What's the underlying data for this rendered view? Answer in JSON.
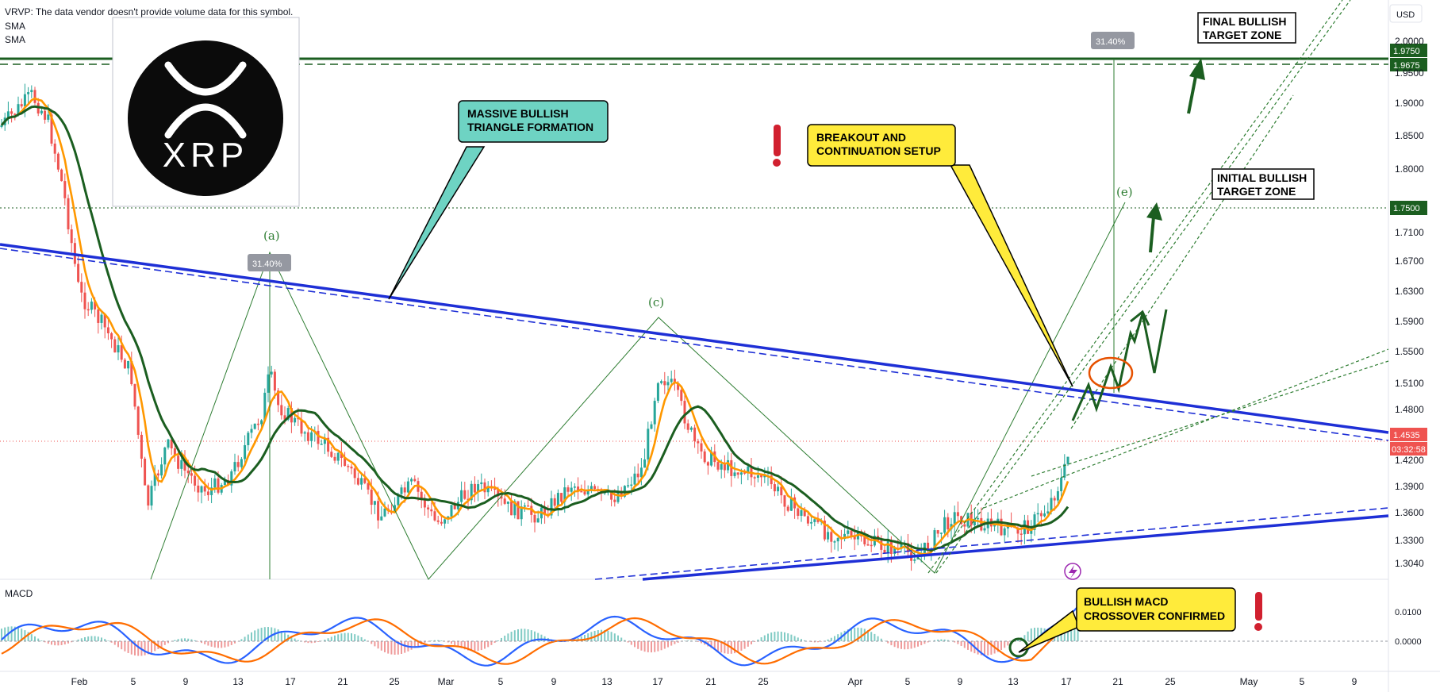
{
  "indicators": {
    "vrvp_note": "VRVP: The data vendor doesn't provide volume data for this symbol.",
    "sma1": "SMA",
    "sma2": "SMA",
    "macd_label": "MACD"
  },
  "logo": {
    "text": "XRP"
  },
  "currency": "USD",
  "colors": {
    "up": "#26a69a",
    "down": "#ef5350",
    "blue": "#1e2fd6",
    "green": "#1b5e20",
    "orange": "#ff9800",
    "macd_line": "#2962ff",
    "signal_line": "#ff6d00",
    "callout_teal": "#6ed3c3",
    "callout_yellow": "#ffeb3b",
    "alert_red": "#d1202f"
  },
  "price_badges": {
    "top1": "1.9750",
    "top2": "1.9675",
    "mid": "1.7500",
    "current": "1.4535",
    "countdown": "03:32:58"
  },
  "macd_ticks": [
    "0.0100",
    "0.0000"
  ],
  "annotations": {
    "triangle": "MASSIVE BULLISH\nTRIANGLE FORMATION",
    "breakout": "BREAKOUT AND\nCONTINUATION SETUP",
    "initial_target": "INITIAL BULLISH\nTARGET ZONE",
    "final_target": "FINAL BULLISH\nTARGET ZONE",
    "macd": "BULLISH MACD\nCROSSOVER CONFIRMED",
    "pct1": "31.40%",
    "pct2": "31.40%",
    "waves": [
      "(a)",
      "(c)",
      "(e)"
    ]
  },
  "chart_data": {
    "type": "candlestick",
    "symbol": "XRP",
    "y_ticks": [
      "2.0000",
      "1.9500",
      "1.9000",
      "1.8500",
      "1.8000",
      "1.7100",
      "1.6700",
      "1.6300",
      "1.5900",
      "1.5500",
      "1.5100",
      "1.4800",
      "1.4200",
      "1.3900",
      "1.3600",
      "1.3300",
      "1.3040"
    ],
    "x_ticks": [
      "Feb",
      "5",
      "9",
      "13",
      "17",
      "21",
      "25",
      "Mar",
      "5",
      "9",
      "13",
      "17",
      "21",
      "25",
      "Apr",
      "5",
      "9",
      "13",
      "17",
      "21",
      "25",
      "May",
      "5",
      "9"
    ],
    "key_levels": {
      "final_target_high": 1.975,
      "final_target_low": 1.9675,
      "initial_target": 1.75,
      "current_price": 1.4535
    },
    "patterns": {
      "triangle_resistance": "descending trendline",
      "triangle_support": "ascending trendline"
    },
    "macd": {
      "signal": "bullish crossover"
    }
  }
}
